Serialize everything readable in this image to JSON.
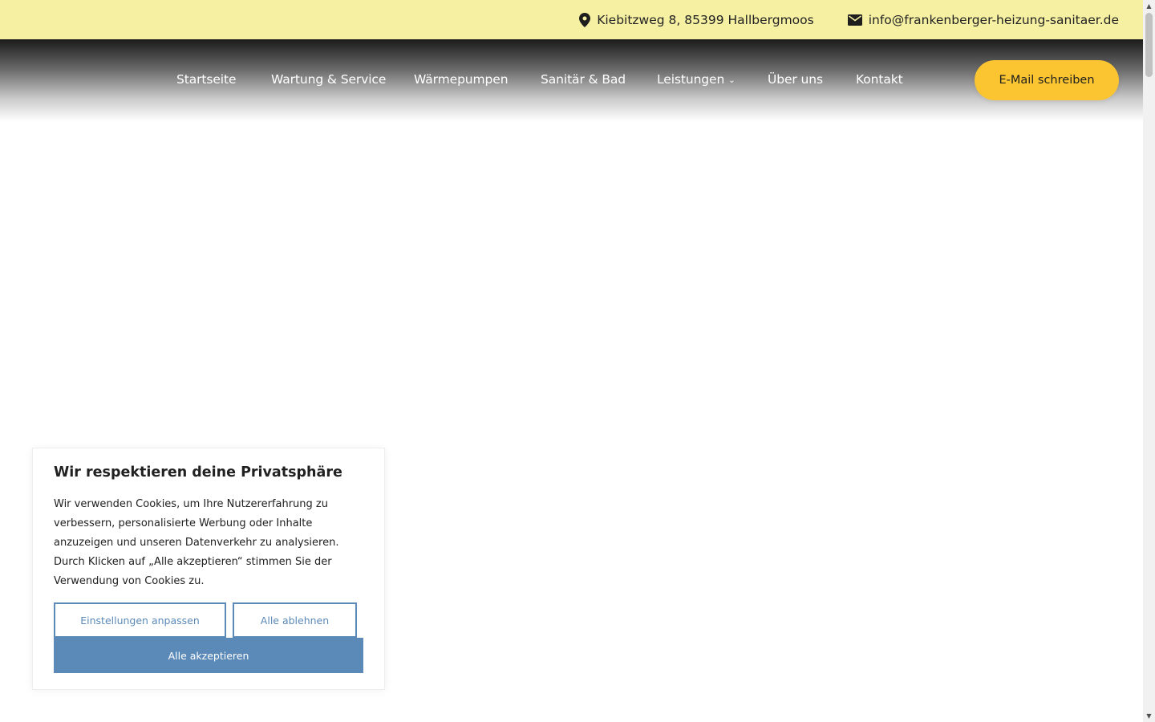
{
  "topbar": {
    "address": "Kiebitzweg 8, 85399 Hallbergmoos",
    "email": "info@frankenberger-heizung-sanitaer.de",
    "address_icon": "location-pin-icon",
    "email_icon": "envelope-icon"
  },
  "nav": {
    "items": [
      {
        "label": "Startseite"
      },
      {
        "label": "Wartung & Service"
      },
      {
        "label": "Wärmepumpen"
      },
      {
        "label": "Sanitär & Bad"
      },
      {
        "label": "Leistungen",
        "has_dropdown": true
      },
      {
        "label": "Über uns"
      },
      {
        "label": "Kontakt"
      }
    ],
    "cta_label": "E-Mail schreiben"
  },
  "cookie_banner": {
    "title": "Wir respektieren deine Privatsphäre",
    "text": "Wir verwenden Cookies, um Ihre Nutzererfahrung zu verbessern, personalisierte Werbung oder Inhalte anzuzeigen und unseren Datenverkehr zu analysieren. Durch Klicken auf „Alle akzeptieren“ stimmen Sie der Verwendung von Cookies zu.",
    "customize_label": "Einstellungen anpassen",
    "reject_label": "Alle ablehnen",
    "accept_label": "Alle akzeptieren"
  },
  "colors": {
    "topbar_bg": "#f6f0a3",
    "cta_bg": "#fbc531",
    "cookie_accent": "#5b8ab8"
  }
}
